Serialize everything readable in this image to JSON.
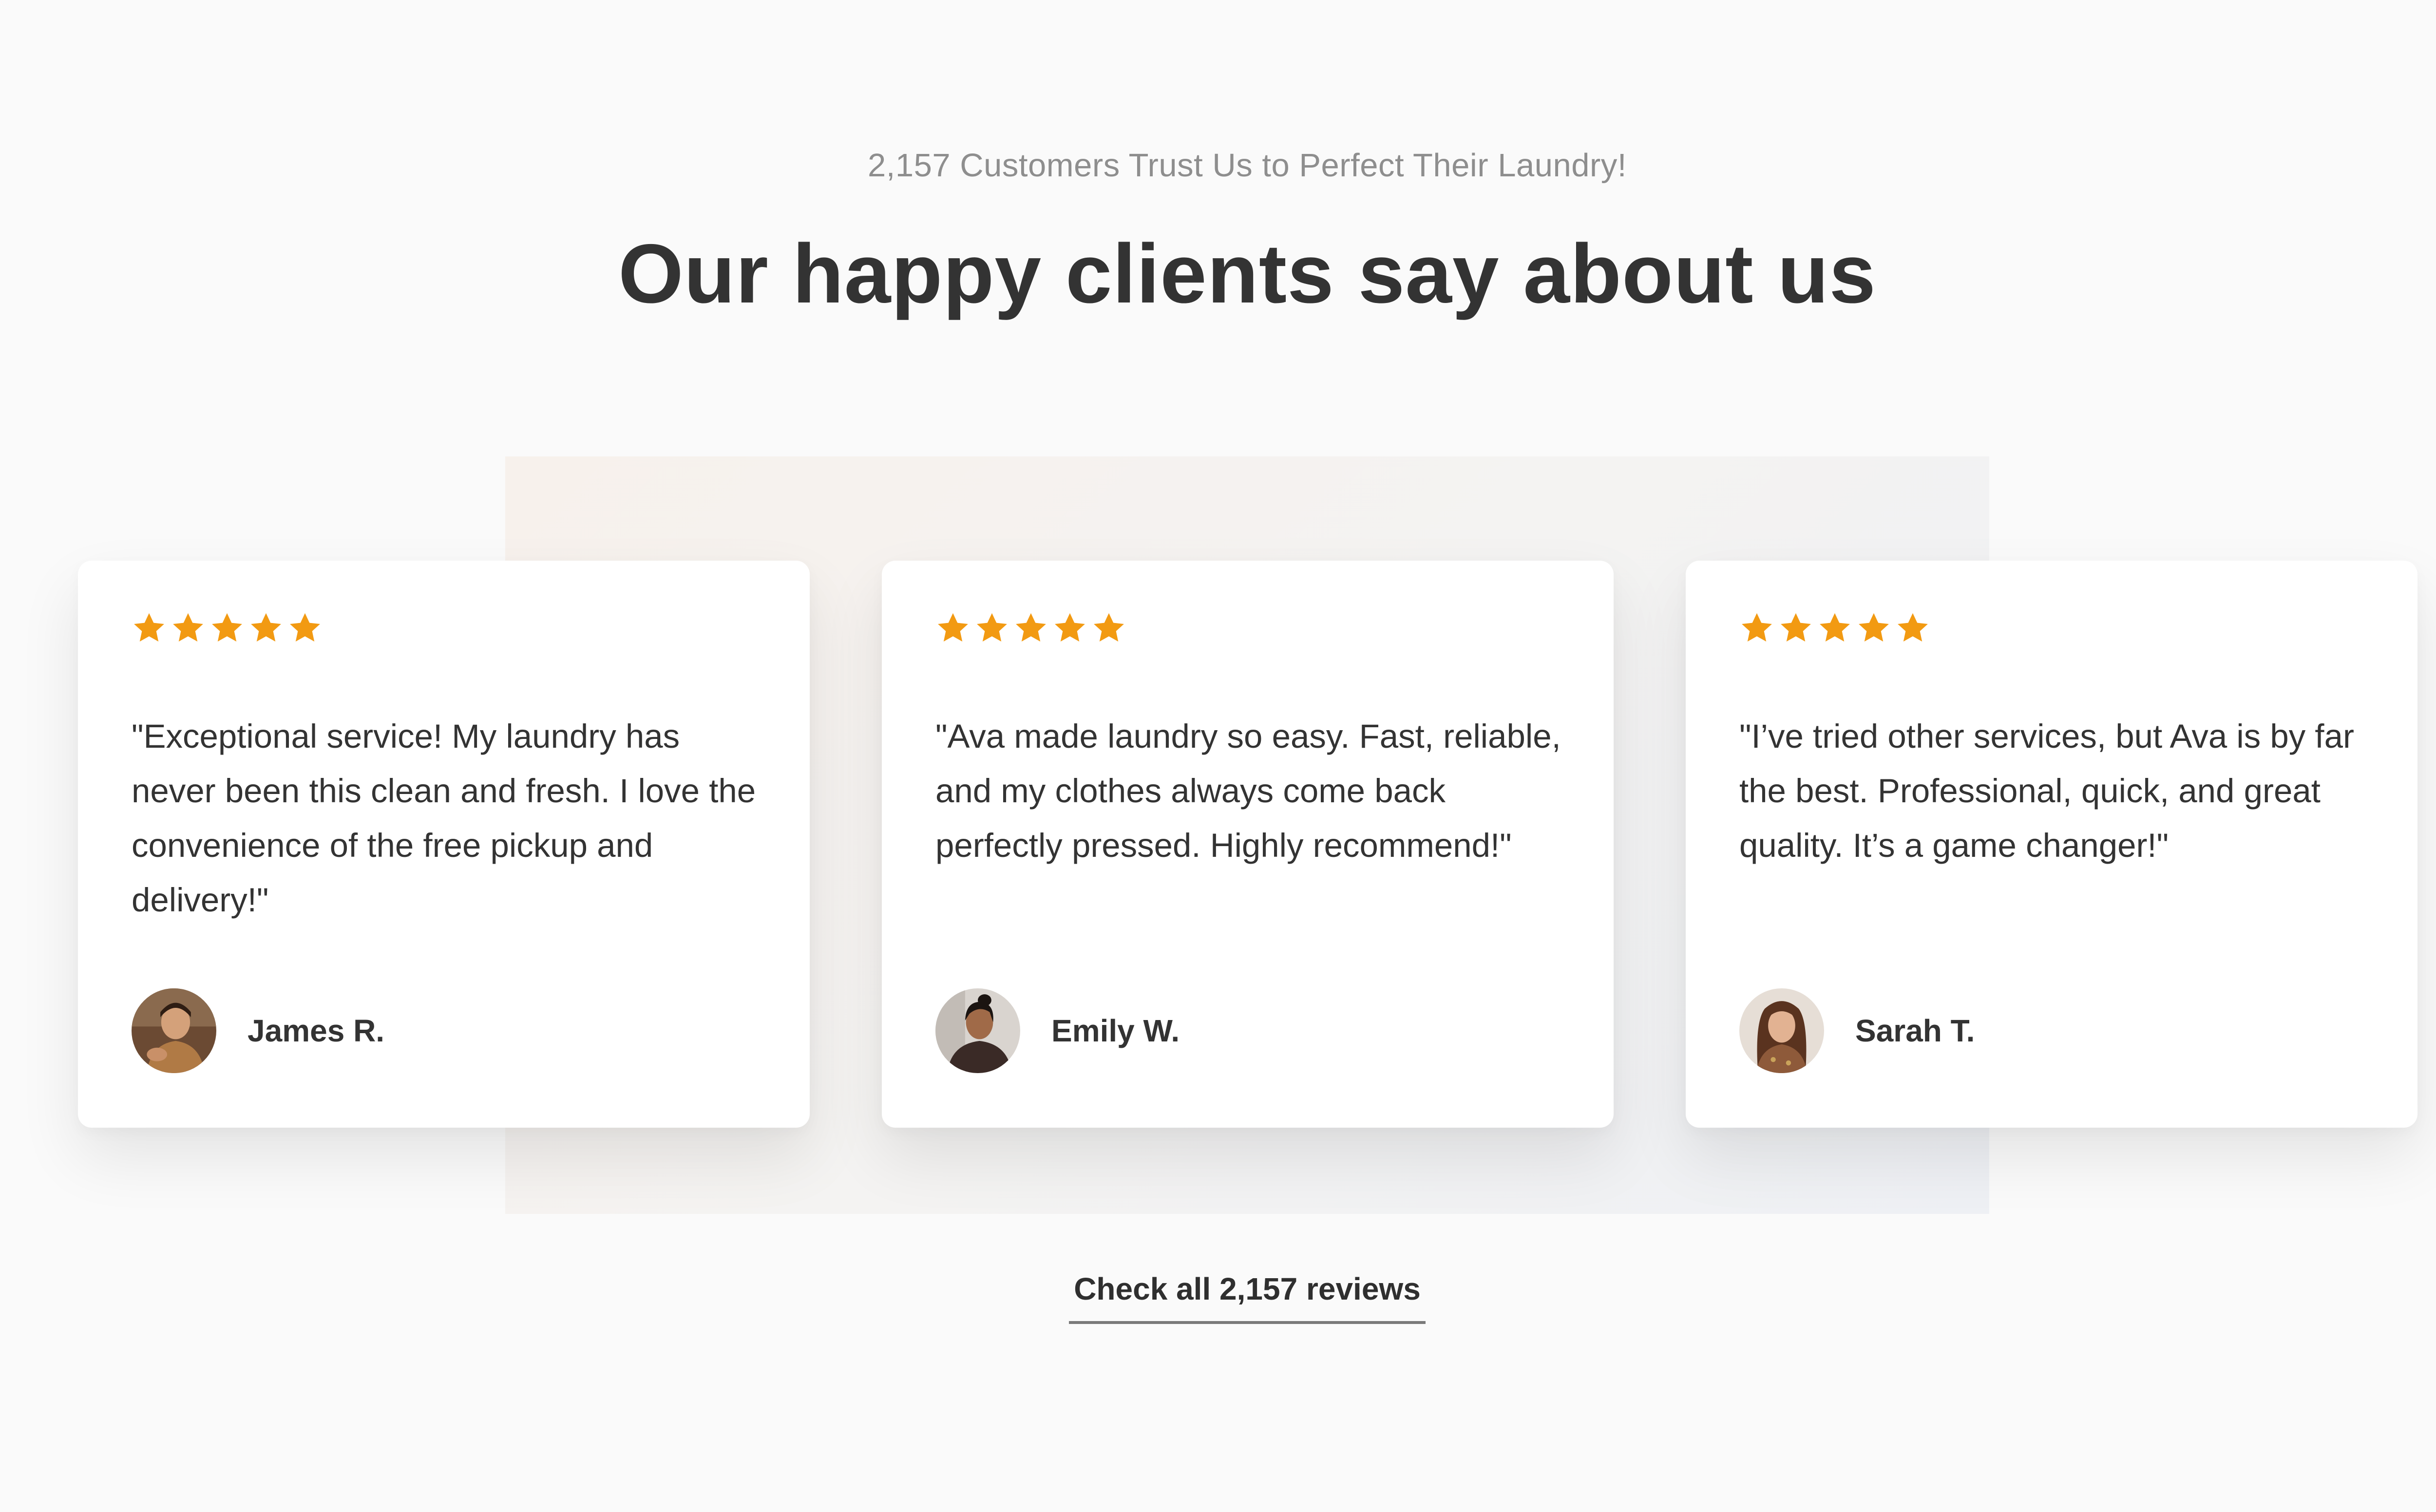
{
  "section": {
    "eyebrow": "2,157 Customers Trust Us to Perfect Their Laundry!",
    "heading": "Our happy clients say about us",
    "cta_label": "Check all 2,157 reviews"
  },
  "colors": {
    "page_background": "#fafafa",
    "card_background": "#ffffff",
    "star": "#f29a12",
    "heading_text": "#333333",
    "eyebrow_text": "#8e8e8e",
    "link_underline": "#7a7a7a"
  },
  "testimonials": [
    {
      "rating": 5,
      "quote": "\"Exceptional service! My laundry has never been this clean and fresh. I love the convenience of the free pickup and delivery!\"",
      "name": "James R."
    },
    {
      "rating": 5,
      "quote": "\"Ava made laundry so easy. Fast, reliable, and my clothes always come back perfectly pressed. Highly recommend!\"",
      "name": "Emily W."
    },
    {
      "rating": 5,
      "quote": "\"I’ve tried other services, but Ava is by far the best. Professional, quick, and great quality. It’s a game changer!\"",
      "name": "Sarah T."
    }
  ]
}
